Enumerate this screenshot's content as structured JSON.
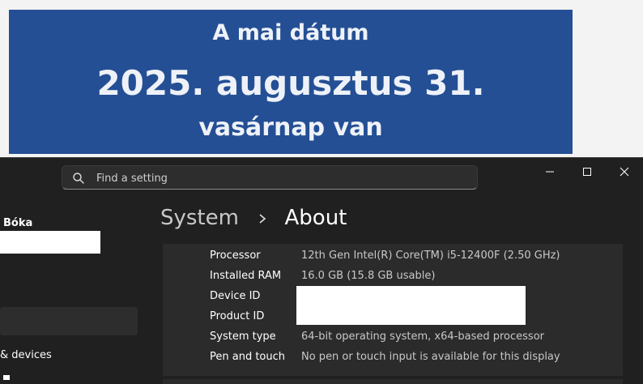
{
  "banner": {
    "line1": "A mai dátum",
    "line2": "2025. augusztus 31.",
    "line3": "vasárnap van",
    "bg_color": "#244f94"
  },
  "settings": {
    "search": {
      "placeholder": "Find a setting",
      "icon": "search-icon"
    },
    "window_controls": [
      "minimize-icon",
      "maximize-icon",
      "close-icon"
    ],
    "user": {
      "name_fragment": "Bóka"
    },
    "nav": {
      "devices_label": "& devices"
    },
    "breadcrumb": {
      "parent": "System",
      "current": "About"
    },
    "specs": [
      {
        "label": "Processor",
        "value": "12th Gen Intel(R) Core(TM) i5-12400F (2.50 GHz)"
      },
      {
        "label": "Installed RAM",
        "value": "16.0 GB (15.8 GB usable)"
      },
      {
        "label": "Device ID",
        "value": ""
      },
      {
        "label": "Product ID",
        "value": ""
      },
      {
        "label": "System type",
        "value": "64-bit operating system, x64-based processor"
      },
      {
        "label": "Pen and touch",
        "value": "No pen or touch input is available for this display"
      }
    ]
  }
}
